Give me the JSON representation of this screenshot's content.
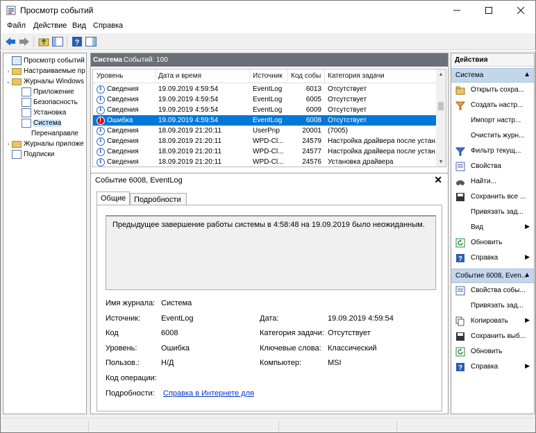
{
  "window": {
    "title": "Просмотр событий"
  },
  "menu": [
    "Файл",
    "Действие",
    "Вид",
    "Справка"
  ],
  "tree": {
    "root": "Просмотр событий (Ло",
    "custom_views": "Настраиваемые пр",
    "windows_logs": "Журналы Windows",
    "application": "Приложение",
    "security": "Безопасность",
    "setup": "Установка",
    "system": "Система",
    "forwarded": "Перенаправле",
    "app_logs": "Журналы приложе",
    "subscriptions": "Подписки"
  },
  "list": {
    "header_name": "Система",
    "header_count": "Событий: 100",
    "columns": [
      "Уровень",
      "Дата и время",
      "Источник",
      "Код собы",
      "Категория задачи"
    ],
    "rows": [
      {
        "level": "Сведения",
        "datetime": "19.09.2019 4:59:54",
        "source": "EventLog",
        "code": "6013",
        "category": "Отсутствует"
      },
      {
        "level": "Сведения",
        "datetime": "19.09.2019 4:59:54",
        "source": "EventLog",
        "code": "6005",
        "category": "Отсутствует"
      },
      {
        "level": "Сведения",
        "datetime": "19.09.2019 4:59:54",
        "source": "EventLog",
        "code": "6009",
        "category": "Отсутствует"
      },
      {
        "level": "Ошибка",
        "datetime": "19.09.2019 4:59:54",
        "source": "EventLog",
        "code": "6008",
        "category": "Отсутствует"
      },
      {
        "level": "Сведения",
        "datetime": "18.09.2019 21:20:11",
        "source": "UserPnp",
        "code": "20001",
        "category": "(7005)"
      },
      {
        "level": "Сведения",
        "datetime": "18.09.2019 21:20:11",
        "source": "WPD-Cl...",
        "code": "24579",
        "category": "Настройка драйвера после устан..."
      },
      {
        "level": "Сведения",
        "datetime": "18.09.2019 21:20:11",
        "source": "WPD-Cl...",
        "code": "24577",
        "category": "Настройка драйвера после устан..."
      },
      {
        "level": "Сведения",
        "datetime": "18.09.2019 21:20:11",
        "source": "WPD-Cl...",
        "code": "24576",
        "category": "Установка драйвера"
      }
    ],
    "selected_row": 3
  },
  "detail": {
    "title": "Событие 6008, EventLog",
    "tab_general": "Общие",
    "tab_details": "Подробности",
    "description": "Предыдущее завершение работы системы в 4:58:48 на 19.09.2019 было неожиданным.",
    "log_name_label": "Имя журнала:",
    "log_name": "Система",
    "source_label": "Источник:",
    "source": "EventLog",
    "date_label": "Дата:",
    "date": "19.09.2019 4:59:54",
    "code_label": "Код",
    "code": "6008",
    "task_label": "Категория задачи:",
    "task": "Отсутствует",
    "level_label": "Уровень:",
    "level": "Ошибка",
    "keywords_label": "Ключевые слова:",
    "keywords": "Классический",
    "user_label": "Пользов.:",
    "user": "Н/Д",
    "computer_label": "Компьютер:",
    "computer": "MSI",
    "opcode_label": "Код операции:",
    "details_label": "Подробности:",
    "details_link": "Справка в Интернете для"
  },
  "actions": {
    "title": "Действия",
    "section1": "Система",
    "items1": [
      {
        "label": "Открыть сохра...",
        "icon": "open-saved-log-icon"
      },
      {
        "label": "Создать настр...",
        "icon": "filter-create-icon"
      },
      {
        "label": "Импорт настр...",
        "icon": "import-icon"
      },
      {
        "label": "Очистить журн...",
        "icon": "clear-log-icon"
      },
      {
        "label": "Фильтр текущ...",
        "icon": "filter-icon"
      },
      {
        "label": "Свойства",
        "icon": "properties-icon"
      },
      {
        "label": "Найти...",
        "icon": "find-icon"
      },
      {
        "label": "Сохранить все ...",
        "icon": "save-icon"
      },
      {
        "label": "Привязать зад...",
        "icon": "attach-task-icon"
      },
      {
        "label": "Вид",
        "icon": "view-icon",
        "sub": true
      },
      {
        "label": "Обновить",
        "icon": "refresh-icon"
      },
      {
        "label": "Справка",
        "icon": "help-icon",
        "sub": true
      }
    ],
    "section2": "Событие 6008, Even...",
    "items2": [
      {
        "label": "Свойства собы...",
        "icon": "event-properties-icon"
      },
      {
        "label": "Привязать зад...",
        "icon": "attach-task-icon"
      },
      {
        "label": "Копировать",
        "icon": "copy-icon",
        "sub": true
      },
      {
        "label": "Сохранить выб...",
        "icon": "save-selected-icon"
      },
      {
        "label": "Обновить",
        "icon": "refresh-icon"
      },
      {
        "label": "Справка",
        "icon": "help-icon",
        "sub": true
      }
    ]
  },
  "colors": {
    "selection": "#0078d7",
    "section_bg": "#c3d7ec",
    "list_header": "#6b7078"
  }
}
